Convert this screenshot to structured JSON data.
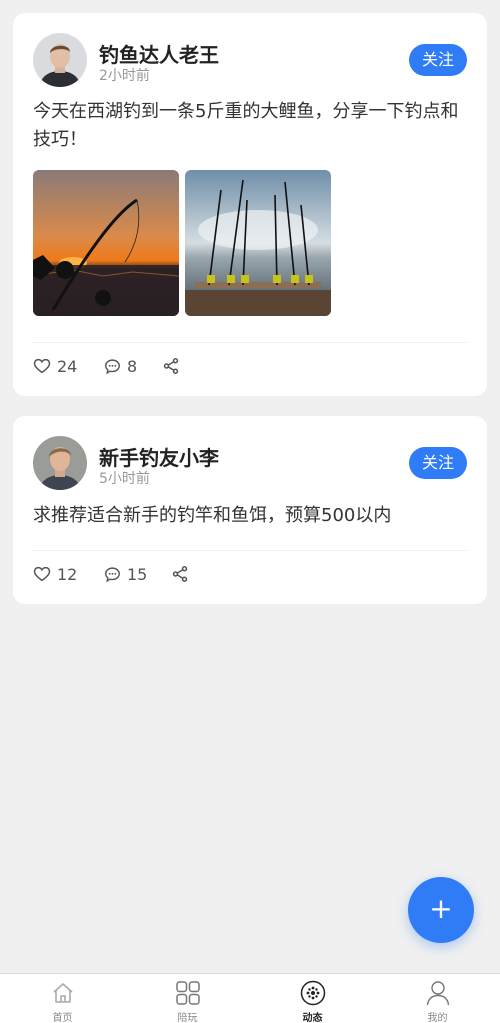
{
  "posts": [
    {
      "username": "钓鱼达人老王",
      "time": "2小时前",
      "follow_label": "关注",
      "content": "今天在西湖钓到一条5斤重的大鲤鱼，分享一下钓点和技巧！",
      "likes": "24",
      "comments": "8"
    },
    {
      "username": "新手钓友小李",
      "time": "5小时前",
      "follow_label": "关注",
      "content": "求推荐适合新手的钓竿和鱼饵，预算500以内",
      "likes": "12",
      "comments": "15"
    }
  ],
  "fab_label": "+",
  "tabs": [
    {
      "label": "首页",
      "icon": "home-icon"
    },
    {
      "label": "陪玩",
      "icon": "grid-icon"
    },
    {
      "label": "动态",
      "icon": "moments-icon",
      "active": true
    },
    {
      "label": "我的",
      "icon": "user-icon"
    }
  ],
  "colors": {
    "accent": "#2f7cf6",
    "background": "#f0f0f0"
  }
}
